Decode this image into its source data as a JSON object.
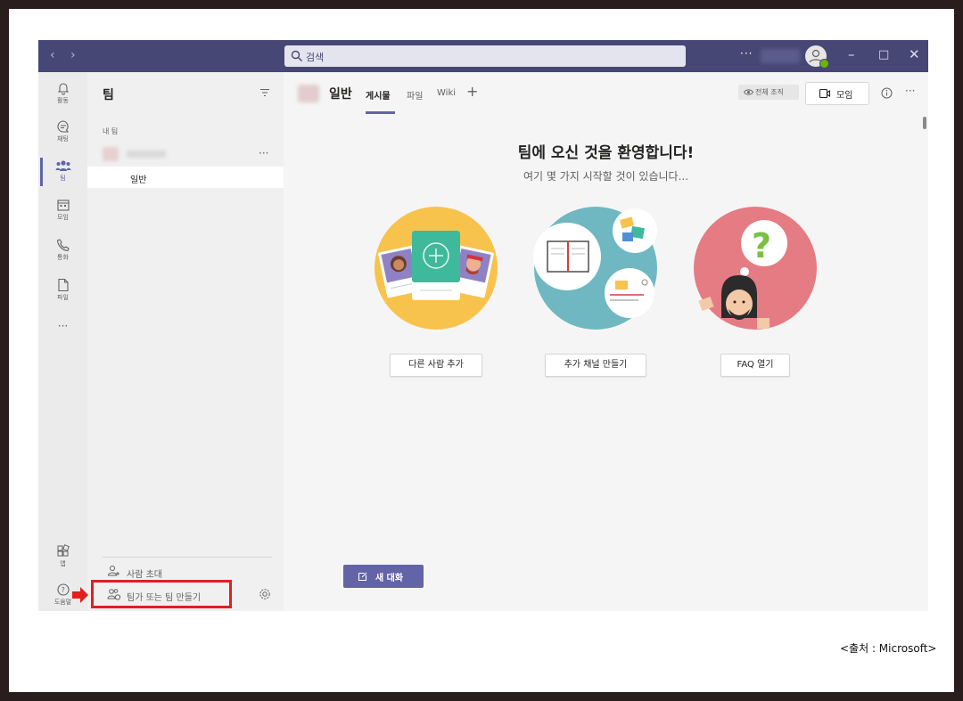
{
  "titlebar": {
    "search_placeholder": "검색",
    "more": "···"
  },
  "rail": {
    "items": [
      {
        "label": "활동",
        "icon": "bell-icon"
      },
      {
        "label": "채팅",
        "icon": "chat-icon"
      },
      {
        "label": "팀",
        "icon": "teams-icon"
      },
      {
        "label": "모임",
        "icon": "calendar-icon"
      },
      {
        "label": "통화",
        "icon": "phone-icon"
      },
      {
        "label": "파일",
        "icon": "file-icon"
      }
    ],
    "more": "···",
    "apps_label": "앱",
    "help_label": "도움말"
  },
  "panel": {
    "title": "팀",
    "section_label": "내 팀",
    "team_more": "···",
    "channel": "일반",
    "invite_label": "사람 초대",
    "join_label": "팀가 또는 팀 만들기"
  },
  "main": {
    "channel_title": "일반",
    "tabs": [
      "게시물",
      "파일",
      "Wiki"
    ],
    "org_label": "전체 조직",
    "meet_label": "모임",
    "welcome_title": "팀에 오신 것을 환영합니다!",
    "welcome_sub": "여기 몇 가지 시작할 것이 있습니다...",
    "actions": [
      "다른 사람 추가",
      "추가 채널 만들기",
      "FAQ 열기"
    ],
    "new_chat": "새 대화"
  },
  "caption": "<출처 : Microsoft>",
  "colors": {
    "brand": "#464775",
    "accent": "#6264a7",
    "highlight": "#e0201f"
  }
}
